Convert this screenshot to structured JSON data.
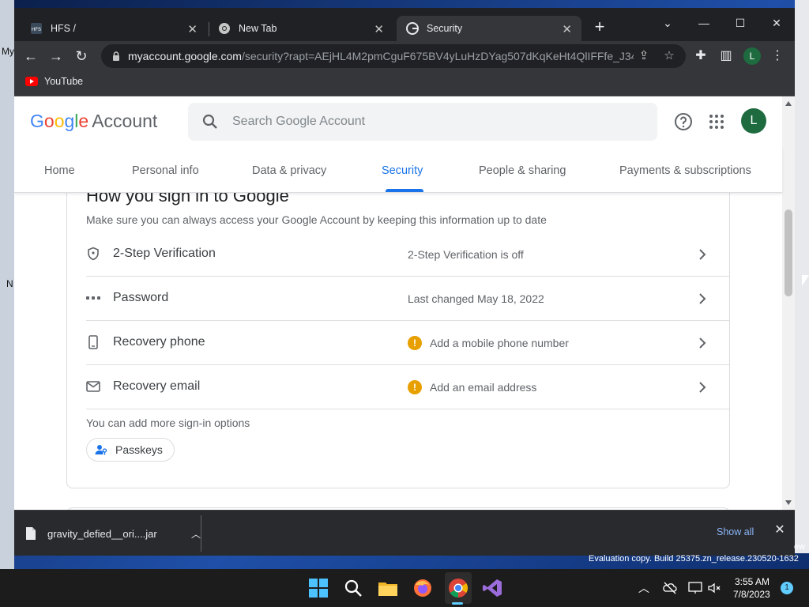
{
  "desktop": {
    "left_fragments": [
      "My",
      "N"
    ],
    "eval_prefix": "ew",
    "eval_text": "Evaluation copy. Build 25375.zn_release.230520-1632"
  },
  "browser": {
    "tabs": [
      {
        "title": "HFS /",
        "icon": "hfs-icon",
        "active": false
      },
      {
        "title": "New Tab",
        "icon": "chrome-icon",
        "active": false
      },
      {
        "title": "Security",
        "icon": "google-icon",
        "active": true
      }
    ],
    "url_host": "myaccount.google.com",
    "url_path": "/security?rapt=AEjHL4M2pmCguF675BV4yLuHzDYag507dKqKeHt4QlIFFfe_J34...",
    "profile_initial": "L",
    "bookmarks": [
      {
        "label": "YouTube",
        "icon": "youtube-icon"
      }
    ]
  },
  "google": {
    "logo_letters": [
      "G",
      "o",
      "o",
      "g",
      "l",
      "e"
    ],
    "logo_suffix": "Account",
    "search_placeholder": "Search Google Account",
    "avatar_initial": "L",
    "tabs": [
      "Home",
      "Personal info",
      "Data & privacy",
      "Security",
      "People & sharing",
      "Payments & subscriptions"
    ],
    "active_tab": "Security"
  },
  "signin": {
    "title": "How you sign in to Google",
    "description": "Make sure you can always access your Google Account by keeping this information up to date",
    "rows": [
      {
        "label": "2-Step Verification",
        "value": "2-Step Verification is off",
        "warning": false,
        "icon": "shield-icon"
      },
      {
        "label": "Password",
        "value": "Last changed May 18, 2022",
        "warning": false,
        "icon": "password-dots-icon"
      },
      {
        "label": "Recovery phone",
        "value": "Add a mobile phone number",
        "warning": true,
        "icon": "phone-icon"
      },
      {
        "label": "Recovery email",
        "value": "Add an email address",
        "warning": true,
        "icon": "mail-icon"
      }
    ],
    "warning_glyph": "!",
    "more_text": "You can add more sign-in options",
    "passkeys_label": "Passkeys"
  },
  "download": {
    "filename": "gravity_defied__ori....jar",
    "show_all": "Show all"
  },
  "taskbar": {
    "time": "3:55 AM",
    "date": "7/8/2023",
    "notification_count": "1"
  },
  "colors": {
    "accent": "#1a73e8",
    "warning": "#e8a000",
    "avatar": "#1e6b3f"
  }
}
